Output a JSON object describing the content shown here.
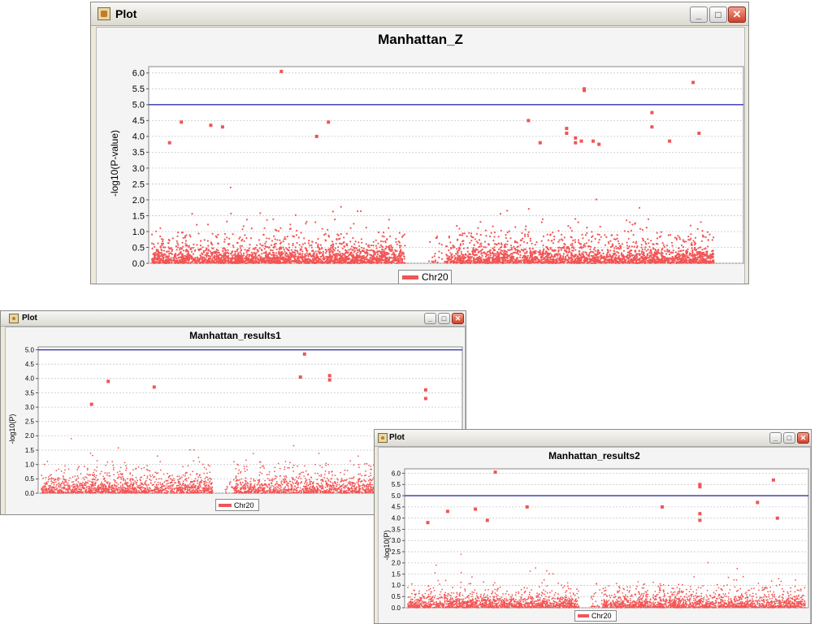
{
  "windows": [
    {
      "id": "z",
      "window_title": "Plot",
      "plot_title": "Manhattan_Z",
      "ylabel": "-log10(P-value)",
      "legend_label": "Chr20",
      "threshold": 5.0,
      "ymax": 6.2,
      "yticks": [
        "0.0",
        "0.5",
        "1.0",
        "1.5",
        "2.0",
        "2.5",
        "3.0",
        "3.5",
        "4.0",
        "4.5",
        "5.0",
        "5.5",
        "6.0"
      ],
      "peaks": [
        [
          0.22,
          6.05
        ],
        [
          0.735,
          5.5
        ],
        [
          0.735,
          5.45
        ],
        [
          0.92,
          5.7
        ],
        [
          0.705,
          4.25
        ],
        [
          0.705,
          4.1
        ],
        [
          0.3,
          4.45
        ],
        [
          0.28,
          4.0
        ],
        [
          0.85,
          4.75
        ],
        [
          0.72,
          3.95
        ],
        [
          0.72,
          3.8
        ],
        [
          0.73,
          3.85
        ],
        [
          0.1,
          4.35
        ],
        [
          0.12,
          4.3
        ],
        [
          0.05,
          4.45
        ],
        [
          0.03,
          3.8
        ],
        [
          0.64,
          4.5
        ],
        [
          0.93,
          4.1
        ],
        [
          0.66,
          3.8
        ],
        [
          0.88,
          3.85
        ],
        [
          0.75,
          3.85
        ],
        [
          0.76,
          3.75
        ],
        [
          0.85,
          4.3
        ]
      ],
      "colors": {
        "points": "#f25454",
        "threshold": "#3333aa"
      }
    },
    {
      "id": "r1",
      "window_title": "Plot",
      "plot_title": "Manhattan_results1",
      "ylabel": "-log10(P)",
      "legend_label": "Chr20",
      "threshold": 5.0,
      "ymax": 5.1,
      "yticks": [
        "0.0",
        "0.5",
        "1.0",
        "1.5",
        "2.0",
        "2.5",
        "3.0",
        "3.5",
        "4.0",
        "4.5",
        "5.0"
      ],
      "peaks": [
        [
          0.63,
          4.85
        ],
        [
          0.69,
          4.1
        ],
        [
          0.69,
          3.95
        ],
        [
          0.62,
          4.05
        ],
        [
          0.16,
          3.9
        ],
        [
          0.27,
          3.7
        ],
        [
          0.92,
          3.6
        ],
        [
          0.92,
          3.3
        ],
        [
          0.12,
          3.1
        ]
      ],
      "colors": {
        "points": "#f25454",
        "threshold": "#3333aa"
      }
    },
    {
      "id": "r2",
      "window_title": "Plot",
      "plot_title": "Manhattan_results2",
      "ylabel": "-log10(P)",
      "legend_label": "Chr20",
      "threshold": 5.0,
      "ymax": 6.2,
      "yticks": [
        "0.0",
        "0.5",
        "1.0",
        "1.5",
        "2.0",
        "2.5",
        "3.0",
        "3.5",
        "4.0",
        "4.5",
        "5.0",
        "5.5",
        "6.0"
      ],
      "peaks": [
        [
          0.22,
          6.05
        ],
        [
          0.735,
          5.5
        ],
        [
          0.735,
          5.4
        ],
        [
          0.92,
          5.7
        ],
        [
          0.735,
          4.2
        ],
        [
          0.735,
          3.9
        ],
        [
          0.17,
          4.4
        ],
        [
          0.2,
          3.9
        ],
        [
          0.3,
          4.5
        ],
        [
          0.88,
          4.7
        ],
        [
          0.1,
          4.3
        ],
        [
          0.05,
          3.8
        ],
        [
          0.93,
          4.0
        ],
        [
          0.64,
          4.5
        ]
      ],
      "colors": {
        "points": "#f25454",
        "threshold": "#3333aa"
      }
    }
  ]
}
